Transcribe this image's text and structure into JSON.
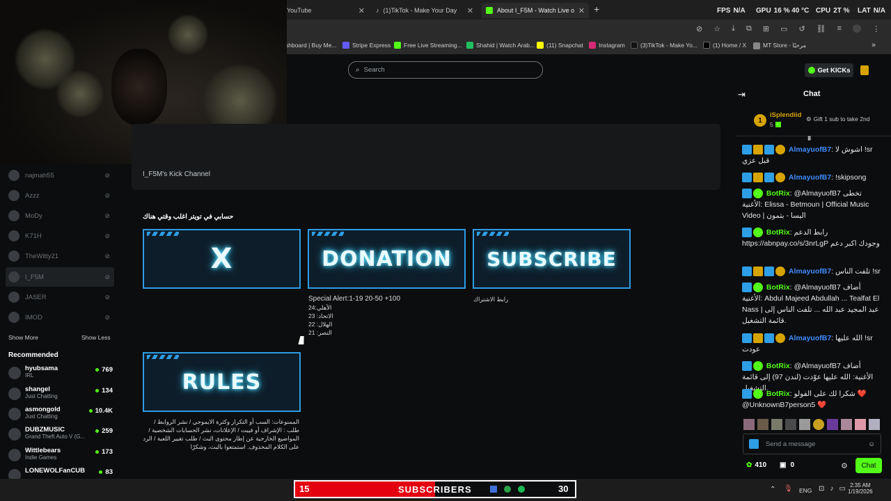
{
  "browser": {
    "tabs": [
      {
        "label": "YouTube",
        "icon": "youtube-icon"
      },
      {
        "label": "(1)TikTok - Make Your Day",
        "icon": "tiktok-icon"
      },
      {
        "label": "About I_F5M - Watch Live on Ki",
        "icon": "kick-icon"
      }
    ],
    "new_tab": "+",
    "hud": {
      "fps_label": "FPS",
      "fps_val": "N/A",
      "gpu_label": "GPU",
      "gpu_val": "16 % 40 °C",
      "cpu_label": "CPU",
      "cpu_val": "2T %",
      "lat_label": "LAT",
      "lat_val": "N/A"
    },
    "bookmarks": [
      {
        "label": "shboard | Buy Me..."
      },
      {
        "label": "Stripe Express"
      },
      {
        "label": "Free Live Streaming..."
      },
      {
        "label": "Shahid | Watch Arab..."
      },
      {
        "label": "(11) Snapchat"
      },
      {
        "label": "Instagram"
      },
      {
        "label": "(3)TikTok - Make Yo..."
      },
      {
        "label": "(1) Home / X"
      },
      {
        "label": "MT Store - مرحبًا"
      }
    ]
  },
  "header": {
    "search_placeholder": "Search",
    "get_kicks": "Get KICKs"
  },
  "sidebar": {
    "following": [
      {
        "name": "najmah55"
      },
      {
        "name": "Azzz"
      },
      {
        "name": "MoDy"
      },
      {
        "name": "K71H"
      },
      {
        "name": "TheWitty21"
      },
      {
        "name": "I_F5M"
      },
      {
        "name": "JASER"
      },
      {
        "name": "IMOD"
      }
    ],
    "show_more": "Show More",
    "show_less": "Show Less",
    "recommended_title": "Recommended",
    "recommended": [
      {
        "name": "hyubsama",
        "category": "IRL",
        "viewers": "769"
      },
      {
        "name": "shangel",
        "category": "Just Chatting",
        "viewers": "134"
      },
      {
        "name": "asmongold",
        "category": "Just Chatting",
        "viewers": "10.4K"
      },
      {
        "name": "DUBZMUSIC",
        "category": "Grand Theft Auto V (G...",
        "viewers": "259"
      },
      {
        "name": "Wittlebears",
        "category": "Indie Games",
        "viewers": "173"
      },
      {
        "name": "LONEWOLFanCUB",
        "category": "",
        "viewers": "83"
      }
    ]
  },
  "about": {
    "channel_desc": "I_F5M's Kick Channel"
  },
  "panels": {
    "heading": "حسابي في تويتر اغلب وقتي هناك",
    "x_title": "X",
    "donation_title": "DONATION",
    "subscribe_title": "SUBSCRIBE",
    "rules_title": "RULES",
    "donation_lines": [
      "Special Alert:1-19 20-50 +100",
      "الأهلي:24",
      "الاتحاد: 23",
      "الهلال: 22",
      "النصر: 21"
    ],
    "subscribe_text": "رابط الاشتراك",
    "rules_text": "الممنوعات: السب أو التكرار وكثرة الايموجي / نشر الروابط / طلب : الإشراف أو فيبت / الإعلانات، نشر الحسابات الشخصية / المواضيع الخارجية عن إطار محتوى البث / طلب تغيير اللعبة / الرد على الكلام المحذوف. استمتعوا بالبث، وشكرًا"
  },
  "chat": {
    "title": "Chat",
    "pinned_user": "iSplendiid",
    "pinned_count": "5",
    "gift_text": "Gift 1 sub to take 2nd",
    "messages": [
      {
        "user": "AlmayuofB7",
        "text": "اشوش لا !sr قبل عزي",
        "color": "#3f8cff"
      },
      {
        "user": "AlmayuofB7",
        "text": "!skipsong",
        "color": "#3f8cff"
      },
      {
        "user": "BotRix",
        "text": "@AlmayuofB7 تخطى الأغنية: Elissa - Betmoun | Official Music Video | اليسا - بتمون",
        "color": "#53fc18"
      },
      {
        "user": "BotRix",
        "text": "رابط الدعم https://abnpay.co/s/3nrLgP وجودك اكبر دعم",
        "color": "#53fc18"
      },
      {
        "user": "AlmayuofB7",
        "text": "تلفت الناس !sr",
        "color": "#3f8cff"
      },
      {
        "user": "BotRix",
        "text": "@AlmayuofB7 أضاف الأغنية: Abdul Majeed Abdullah ... Tealfat El Nass | عبد المجيد عبد الله ... تلفت الناس إلى قائمة التشغيل.",
        "color": "#53fc18"
      },
      {
        "user": "AlmayuofB7",
        "text": "الله عليها !sr عودت",
        "color": "#3f8cff"
      },
      {
        "user": "BotRix",
        "text": "@AlmayuofB7 أضاف الأغنية: الله عليها عوّدت (لندن 97) إلى قائمة التشغيل.",
        "color": "#53fc18"
      },
      {
        "user": "BotRix",
        "text": "شكرا لك على الفولو ❤️ @UnknownB7person5 ❤️",
        "color": "#53fc18"
      }
    ],
    "input_placeholder": "Send a message",
    "points": "410",
    "redeem_count": "0",
    "send_label": "Chat"
  },
  "subs_bar": {
    "current": "15",
    "label": "SUBSCRIBERS",
    "goal": "30",
    "progress": 0.5
  },
  "taskbar": {
    "lang": "ENG",
    "time": "2:35 AM",
    "date": "1/19/2026"
  },
  "colors": {
    "kick_green": "#53fc18",
    "panel_border": "#2e9ee5",
    "subs_red": "#e3000f",
    "username_blue": "#3f8cff"
  }
}
